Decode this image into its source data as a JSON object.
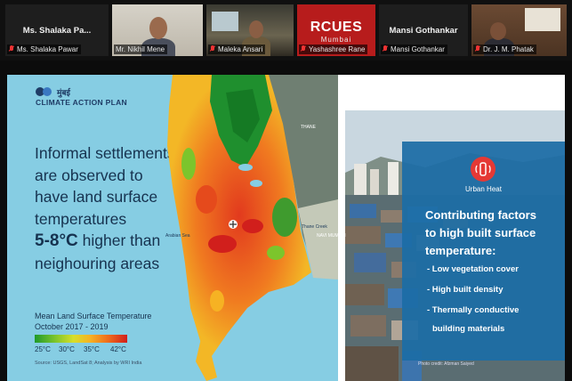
{
  "participants": [
    {
      "big_name": "Ms. Shalaka Pa...",
      "label": "Ms. Shalaka Pawar",
      "muted": true,
      "video": false
    },
    {
      "big_name": "",
      "label": "Mr. Nikhil Mene",
      "muted": false,
      "video": true,
      "active": true
    },
    {
      "big_name": "",
      "label": "Maleka Ansari",
      "muted": true,
      "video": true
    },
    {
      "big_name": "",
      "label": "Yashashree Rane",
      "muted": true,
      "video": true,
      "logo_text": "RCUES",
      "logo_sub": "Mumbai"
    },
    {
      "big_name": "Mansi Gothankar",
      "label": "Mansi Gothankar",
      "muted": true,
      "video": false
    },
    {
      "big_name": "",
      "label": "Dr. J. M. Phatak",
      "muted": true,
      "video": true
    }
  ],
  "slide": {
    "logo_devanagari": "मुंबई",
    "logo_name": "CLIMATE ACTION PLAN",
    "headline_lines": [
      "Informal settlements",
      "are observed to",
      "have land surface",
      "temperatures"
    ],
    "headline_bold": "5-8°C",
    "headline_after_bold": " higher than",
    "headline_last": "neighouring areas",
    "legend_title_lines": [
      "Mean Land Surface Temperature",
      "October 2017 - 2019"
    ],
    "legend_ticks": [
      "25°C",
      "30°C",
      "35°C",
      "42°C"
    ],
    "source": "Source: USGS, LandSat 8; Analysis by WRI India",
    "map_labels": [
      "Arabian Sea",
      "THANE",
      "NAVI MUMBAI",
      "Thane Creek"
    ],
    "panel": {
      "icon": "urban-heat-icon",
      "label": "Urban Heat",
      "title_lines": [
        "Contributing factors",
        "to high built surface",
        "temperature:"
      ],
      "bullets": [
        "- Low vegetation cover",
        "- High built density",
        "- Thermally conductive",
        "building materials"
      ]
    },
    "photo_credit": "Photo credit: Afzman Saiyed"
  },
  "colors": {
    "accent_green": "#3dd13d",
    "mic_muted": "#e33",
    "map_hot": "#d11f1c",
    "map_cool": "#1f9a2a",
    "panel_blue": "#1c6da6",
    "sea": "#86cde3",
    "text_dark": "#16324f"
  }
}
